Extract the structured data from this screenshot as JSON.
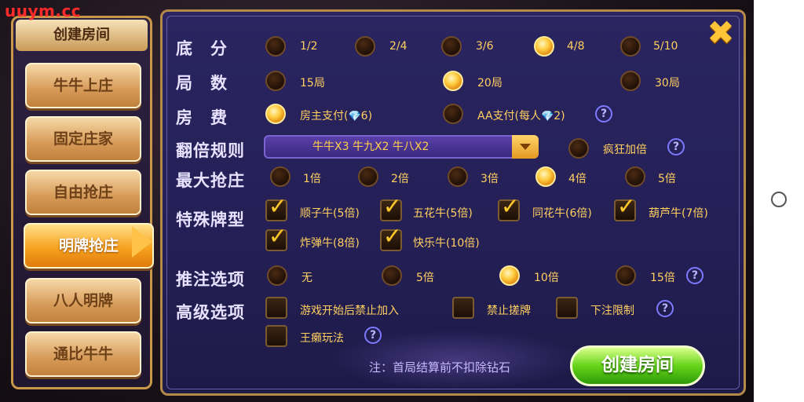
{
  "watermark": "uuym.cc",
  "left": {
    "title": "创建房间",
    "items": [
      "牛牛上庄",
      "固定庄家",
      "自由抢庄",
      "明牌抢庄",
      "八人明牌",
      "通比牛牛"
    ],
    "active_index": 3
  },
  "rows": {
    "base_score": {
      "label": "底　分",
      "options": [
        "1/2",
        "2/4",
        "3/6",
        "4/8",
        "5/10"
      ],
      "selected": "4/8"
    },
    "rounds": {
      "label": "局　数",
      "options": [
        "15局",
        "20局",
        "30局"
      ],
      "selected": "20局"
    },
    "room_fee": {
      "label": "房　费",
      "options": [
        "房主支付(",
        "6)",
        "AA支付(每人",
        "2)"
      ],
      "selected": "房主支付"
    },
    "double_rule": {
      "label": "翻倍规则",
      "dropdown_value": "牛牛X3  牛九X2  牛八X2",
      "crazy_double": "疯狂加倍"
    },
    "max_banker": {
      "label": "最大抢庄",
      "options": [
        "1倍",
        "2倍",
        "3倍",
        "4倍",
        "5倍"
      ],
      "selected": "4倍"
    },
    "special": {
      "label": "特殊牌型",
      "options": [
        "顺子牛(5倍)",
        "五花牛(5倍)",
        "同花牛(6倍)",
        "葫芦牛(7倍)",
        "炸弹牛(8倍)",
        "快乐牛(10倍)"
      ]
    },
    "push_bet": {
      "label": "推注选项",
      "options": [
        "无",
        "5倍",
        "10倍",
        "15倍"
      ],
      "selected": "10倍"
    },
    "advanced": {
      "label": "高级选项",
      "options": [
        "游戏开始后禁止加入",
        "禁止搓牌",
        "下注限制",
        "王癞玩法"
      ]
    }
  },
  "help_icon": "?",
  "close_icon": "✖",
  "note": "注：首局结算前不扣除钻石",
  "create_button": "创建房间"
}
